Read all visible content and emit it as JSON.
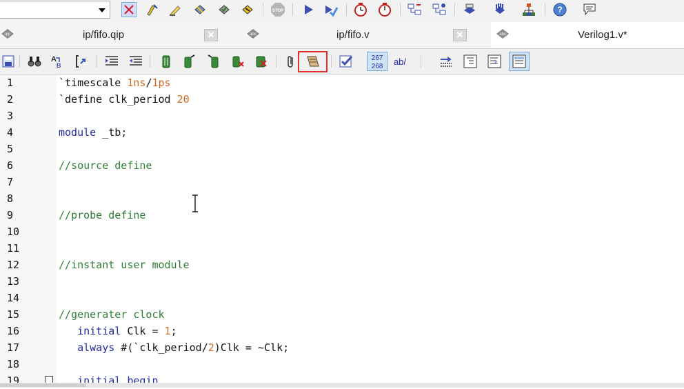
{
  "toolbar_icons": [
    "compile-icon",
    "analysis-icon",
    "highlight-icon",
    "assembler-icon",
    "timing-icon",
    "netlist-icon",
    "stop-icon",
    "start-icon",
    "compile-design-icon",
    "timer-icon",
    "timer-reset-icon",
    "rtl-viewer-icon",
    "technology-viewer-icon",
    "programmer-icon",
    "signaltap-icon",
    "tree-icon",
    "help-icon",
    "comment-icon"
  ],
  "tabs": [
    {
      "label": "ip/fifo.qip",
      "icon": "qip-file-icon",
      "active": false
    },
    {
      "label": "ip/fifo.v",
      "icon": "verilog-file-icon",
      "active": false
    },
    {
      "label": "Verilog1.v*",
      "icon": "verilog-file-icon",
      "active": true
    }
  ],
  "editor_toolbar_icons": [
    "save-icon",
    "find-icon",
    "replace-icon",
    "goto-icon",
    "indent-icon",
    "unindent-icon",
    "bookmark-icon",
    "prev-bookmark-icon",
    "next-bookmark-icon",
    "clear-bookmark-icon",
    "delete-bookmark-icon",
    "attach-icon",
    "template-icon",
    "validate-icon",
    "line-number-icon",
    "spell-icon",
    "word-wrap-icon",
    "block-icon",
    "column-icon",
    "show-whitespace-icon"
  ],
  "line_number_badge": {
    "top": "267",
    "bottom": "268"
  },
  "word_wrap_label": "ab/",
  "code_lines": [
    {
      "n": "1",
      "parts": [
        [
          "plain",
          "`timescale "
        ],
        [
          "num",
          "1ns"
        ],
        [
          "plain",
          "/"
        ],
        [
          "num",
          "1ps"
        ]
      ]
    },
    {
      "n": "2",
      "parts": [
        [
          "plain",
          "`define clk_period "
        ],
        [
          "num",
          "20"
        ]
      ]
    },
    {
      "n": "3",
      "parts": []
    },
    {
      "n": "4",
      "parts": [
        [
          "kw",
          "module"
        ],
        [
          "plain",
          " _tb;"
        ]
      ]
    },
    {
      "n": "5",
      "parts": []
    },
    {
      "n": "6",
      "parts": [
        [
          "cm",
          "//source define"
        ]
      ]
    },
    {
      "n": "7",
      "parts": []
    },
    {
      "n": "8",
      "parts": []
    },
    {
      "n": "9",
      "parts": [
        [
          "cm",
          "//probe define"
        ]
      ]
    },
    {
      "n": "10",
      "parts": []
    },
    {
      "n": "11",
      "parts": []
    },
    {
      "n": "12",
      "parts": [
        [
          "cm",
          "//instant user module"
        ]
      ]
    },
    {
      "n": "13",
      "parts": []
    },
    {
      "n": "14",
      "parts": []
    },
    {
      "n": "15",
      "parts": [
        [
          "cm",
          "//generater clock"
        ]
      ]
    },
    {
      "n": "16",
      "parts": [
        [
          "plain",
          "   "
        ],
        [
          "kw",
          "initial"
        ],
        [
          "plain",
          " Clk = "
        ],
        [
          "num",
          "1"
        ],
        [
          "plain",
          ";"
        ]
      ]
    },
    {
      "n": "17",
      "parts": [
        [
          "plain",
          "   "
        ],
        [
          "kw",
          "always"
        ],
        [
          "plain",
          " #(`clk_period/"
        ],
        [
          "num",
          "2"
        ],
        [
          "plain",
          ")Clk = ~Clk;"
        ]
      ]
    },
    {
      "n": "18",
      "parts": []
    },
    {
      "n": "19",
      "parts": [
        [
          "plain",
          "   "
        ],
        [
          "kw",
          "initial begin"
        ]
      ]
    }
  ],
  "colors": {
    "keyword": "#1f2aa3",
    "comment": "#2e7d32",
    "number": "#d2691e",
    "highlight": "#e03030"
  }
}
